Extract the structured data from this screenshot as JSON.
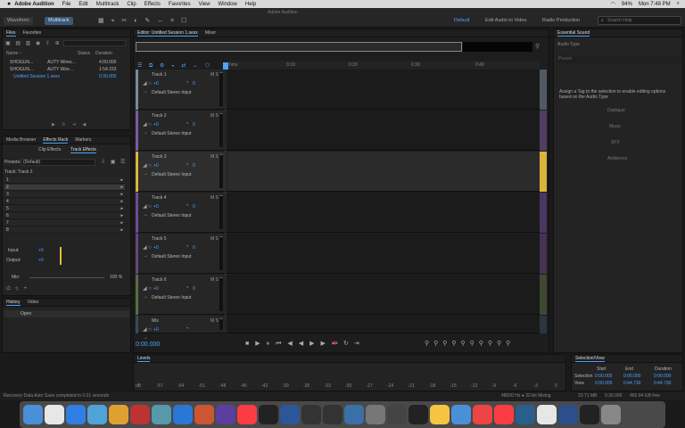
{
  "menubar": {
    "apple": "",
    "app": "Adobe Audition",
    "items": [
      "File",
      "Edit",
      "Multitrack",
      "Clip",
      "Effects",
      "Favorites",
      "View",
      "Window",
      "Help"
    ],
    "battery": "94%",
    "clock": "Mon 7:48 PM"
  },
  "window": {
    "title": "Adobe Audition"
  },
  "toolbar": {
    "waveform": "Waveform",
    "multitrack": "Multitrack",
    "workspace_default": "Default",
    "workspace_edit_video": "Edit Audio to Video",
    "workspace_radio": "Radio Production",
    "search_placeholder": "Search Help"
  },
  "files_panel": {
    "tabs": [
      "Files",
      "Favorites"
    ],
    "col_name": "Name ↑",
    "col_status": "Status",
    "col_duration": "Duration",
    "rows": [
      {
        "name": "SHOGUN...",
        "file": "AUTY Wires...",
        "dur": "4:00.000"
      },
      {
        "name": "SHOGUN...",
        "file": "AUTY Wire...",
        "dur": "1:54.153"
      },
      {
        "name": "Untitled Session 1.sesx",
        "file": "",
        "dur": "0:30.000"
      }
    ]
  },
  "fx_panel": {
    "tabs": [
      "Media Browser",
      "Effects Rack",
      "Markers"
    ],
    "subtabs": [
      "Clip Effects",
      "Track Effects"
    ],
    "presets_label": "Presets:",
    "preset_value": "(Default)",
    "track_label": "Track: Track 2",
    "slots": [
      "1",
      "2",
      "3",
      "4",
      "5",
      "6",
      "7",
      "8"
    ],
    "input_label": "Input:",
    "output_label": "Output:",
    "mix_label": "Mix:",
    "input_val": "+0",
    "output_val": "+0",
    "mix_val": "100 %"
  },
  "history_panel": {
    "tabs": [
      "History",
      "Video"
    ],
    "item": "Open"
  },
  "editor": {
    "title": "Editor: Untitled Session 1.sesx",
    "tab2": "Mixer",
    "timecode": "0:00.000",
    "ruler": [
      "hms",
      "0:10",
      "0:20",
      "0:30",
      "0:40"
    ]
  },
  "tracks": [
    {
      "name": "Track 1",
      "vol": "+0",
      "pan": "0",
      "input": "Default Stereo Input",
      "color": "#7b8a9c"
    },
    {
      "name": "Track 2",
      "vol": "+0",
      "pan": "0",
      "input": "Default Stereo Input",
      "color": "#7c5a9e"
    },
    {
      "name": "Track 3",
      "vol": "+0",
      "pan": "0",
      "input": "Default Stereo Input",
      "color": "#d7b53a"
    },
    {
      "name": "Track 4",
      "vol": "+0",
      "pan": "0",
      "input": "Default Stereo Input",
      "color": "#6a4d99"
    },
    {
      "name": "Track 5",
      "vol": "+0",
      "pan": "0",
      "input": "Default Stereo Input",
      "color": "#64467f"
    },
    {
      "name": "Track 6",
      "vol": "+0",
      "pan": "0",
      "input": "Default Stereo Input",
      "color": "#5a6b44"
    },
    {
      "name": "Mix",
      "vol": "+0",
      "pan": "",
      "input": "",
      "color": "#38485c"
    }
  ],
  "essential_sound": {
    "title": "Essential Sound",
    "subtitle": "Audio Type",
    "preset_placeholder": "Preset:",
    "message": "Assign a Tag to the selection to enable editing options based on the Audio Type",
    "types": [
      "Dialogue",
      "Music",
      "SFX",
      "Ambience"
    ]
  },
  "levels": {
    "title": "Levels",
    "scale": [
      "dB",
      "-57",
      "-54",
      "-51",
      "-48",
      "-45",
      "-42",
      "-39",
      "-36",
      "-33",
      "-30",
      "-27",
      "-24",
      "-21",
      "-18",
      "-15",
      "-12",
      "-9",
      "-6",
      "-3",
      "0"
    ]
  },
  "selection_view": {
    "title": "Selection/View",
    "col_start": "Start",
    "col_end": "End",
    "col_duration": "Duration",
    "selection_label": "Selection",
    "view_label": "View",
    "sel_start": "0:00.000",
    "sel_end": "0:00.000",
    "sel_dur": "0:00.000",
    "view_start": "0:00.000",
    "view_end": "0:44.730",
    "view_dur": "0:44.730"
  },
  "statusbar": {
    "left": "Recovery Data Auto Save completed in 0.01 seconds",
    "rate": "48000 Hz ● 32-bit Mixing",
    "mem": "23.71 MB",
    "dur": "0:30.000",
    "free": "460.04 GB free"
  },
  "dock": [
    "Finder",
    "Chrome",
    "Safari",
    "Preview",
    "Photos",
    "Scripts",
    "Toolbox",
    "Safari",
    "Instagram",
    "Alfred",
    "Music",
    "W",
    "Word",
    "E",
    "D",
    "Lr",
    "Tools",
    "Piano",
    "Clock",
    "Notes",
    "Finder",
    "Block",
    "Music",
    "Au",
    "Chrome",
    "Info",
    "Terminal",
    "Trash"
  ]
}
